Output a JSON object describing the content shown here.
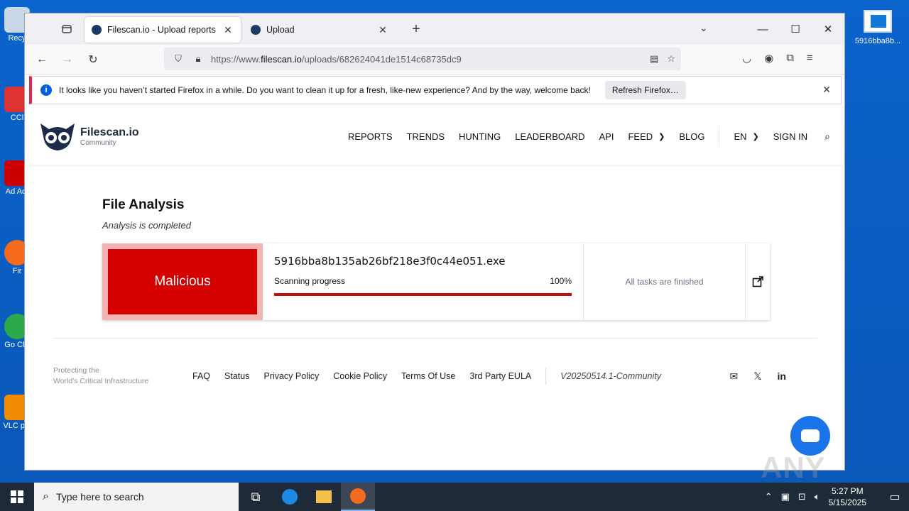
{
  "desktop": {
    "left_icons": [
      "Recy",
      "CCl",
      "Ad Acr",
      "Fir",
      "Go Chr",
      "VLC pla"
    ],
    "right_icon_label": "5916bba8b..."
  },
  "browser": {
    "tabs": [
      {
        "title": "Filescan.io - Upload reports",
        "active": true
      },
      {
        "title": "Upload",
        "active": false
      }
    ],
    "url_prefix": "https://www.",
    "url_host": "filescan.io",
    "url_path": "/uploads/682624041de1514c68735dc9",
    "infobar": {
      "message": "It looks like you haven’t started Firefox in a while. Do you want to clean it up for a fresh, like-new experience? And by the way, welcome back!",
      "button": "Refresh Firefox…"
    }
  },
  "site": {
    "brand": "Filescan.io",
    "brand_sub": "Community",
    "menu": [
      "REPORTS",
      "TRENDS",
      "HUNTING",
      "LEADERBOARD",
      "API",
      "FEED",
      "BLOG",
      "EN",
      "SIGN IN"
    ]
  },
  "analysis": {
    "title": "File Analysis",
    "status": "Analysis is completed",
    "verdict": "Malicious",
    "file_name": "5916bba8b135ab26bf218e3f0c44e051.exe",
    "progress_label": "Scanning progress",
    "progress_value": "100%",
    "progress_fraction": 1.0,
    "tasks_status": "All tasks are finished"
  },
  "footer": {
    "tagline_1": "Protecting the",
    "tagline_2": "World's Critical Infrastructure",
    "links": [
      "FAQ",
      "Status",
      "Privacy Policy",
      "Cookie Policy",
      "Terms Of Use",
      "3rd Party EULA"
    ],
    "version": "V20250514.1-Community"
  },
  "watermark": "ANY RUN",
  "taskbar": {
    "search_placeholder": "Type here to search",
    "time": "5:27 PM",
    "date": "5/15/2025"
  },
  "colors": {
    "verdict_red": "#d50000",
    "progress_red": "#c20d0d",
    "taskbar": "#1f2a38",
    "desktop": "#0b63cc"
  }
}
